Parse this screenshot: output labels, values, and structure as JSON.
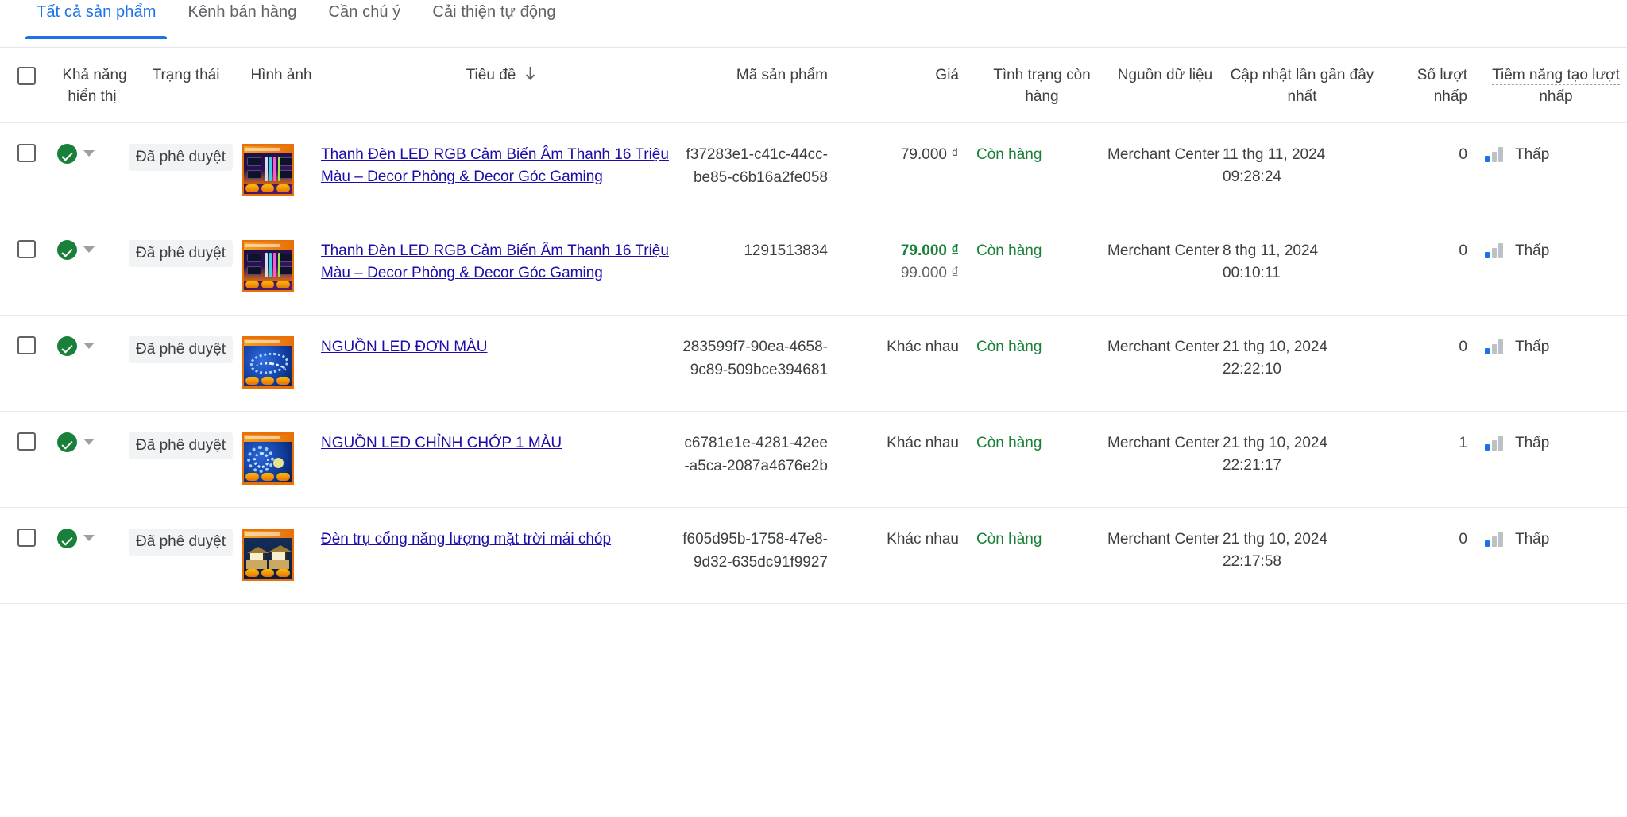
{
  "tabs": [
    {
      "label": "Tất cả sản phẩm",
      "active": true
    },
    {
      "label": "Kênh bán hàng",
      "active": false
    },
    {
      "label": "Cần chú ý",
      "active": false
    },
    {
      "label": "Cải thiện tự động",
      "active": false
    }
  ],
  "table": {
    "headers": {
      "select_all": "",
      "visibility": "Khả năng hiển thị",
      "status": "Trạng thái",
      "image": "Hình ảnh",
      "title": "Tiêu đề",
      "title_sort": "↓",
      "sku": "Mã sản phẩm",
      "price": "Giá",
      "stock": "Tình trạng còn hàng",
      "source": "Nguồn dữ liệu",
      "updated": "Cập nhật lần gần đây nhất",
      "clicks": "Số lượt nhấp",
      "potential": "Tiềm năng tạo lượt nhấp"
    },
    "rows": [
      {
        "status": "Đã phê duyệt",
        "image_variant": "a",
        "title": "Thanh Đèn LED RGB Cảm Biến Âm Thanh 16 Triệu Màu – Decor Phòng & Decor Góc Gaming",
        "sku": "f37283e1-c41c-44cc-be85-c6b16a2fe058",
        "price": "79.000 ₫",
        "price_old": "",
        "price_sale": false,
        "stock": "Còn hàng",
        "source": "Merchant Center",
        "updated_date": "11 thg 11, 2024",
        "updated_time": "09:28:24",
        "clicks": "0",
        "potential": "Thấp"
      },
      {
        "status": "Đã phê duyệt",
        "image_variant": "a",
        "title": "Thanh Đèn LED RGB Cảm Biến Âm Thanh 16 Triệu Màu – Decor Phòng & Decor Góc Gaming",
        "sku": "1291513834",
        "price": "79.000 ₫",
        "price_old": "99.000 ₫",
        "price_sale": true,
        "stock": "Còn hàng",
        "source": "Merchant Center",
        "updated_date": "8 thg 11, 2024",
        "updated_time": "00:10:11",
        "clicks": "0",
        "potential": "Thấp"
      },
      {
        "status": "Đã phê duyệt",
        "image_variant": "b",
        "title": "NGUỒN LED ĐƠN MÀU",
        "sku": "283599f7-90ea-4658-9c89-509bce394681",
        "price": "Khác nhau",
        "price_old": "",
        "price_sale": false,
        "stock": "Còn hàng",
        "source": "Merchant Center",
        "updated_date": "21 thg 10, 2024",
        "updated_time": "22:22:10",
        "clicks": "0",
        "potential": "Thấp"
      },
      {
        "status": "Đã phê duyệt",
        "image_variant": "c",
        "title": "NGUỒN LED CHỈNH CHỚP 1 MÀU",
        "sku": "c6781e1e-4281-42ee-a5ca-2087a4676e2b",
        "price": "Khác nhau",
        "price_old": "",
        "price_sale": false,
        "stock": "Còn hàng",
        "source": "Merchant Center",
        "updated_date": "21 thg 10, 2024",
        "updated_time": "22:21:17",
        "clicks": "1",
        "potential": "Thấp"
      },
      {
        "status": "Đã phê duyệt",
        "image_variant": "d",
        "title": "Đèn trụ cổng năng lượng mặt trời mái chóp",
        "sku": "f605d95b-1758-47e8-9d32-635dc91f9927",
        "price": "Khác nhau",
        "price_old": "",
        "price_sale": false,
        "stock": "Còn hàng",
        "source": "Merchant Center",
        "updated_date": "21 thg 10, 2024",
        "updated_time": "22:17:58",
        "clicks": "0",
        "potential": "Thấp"
      }
    ]
  },
  "colors": {
    "accent": "#1a73e8",
    "link": "#1a0dab",
    "success": "#188038",
    "text": "#3c4043",
    "muted": "#5f6368"
  }
}
